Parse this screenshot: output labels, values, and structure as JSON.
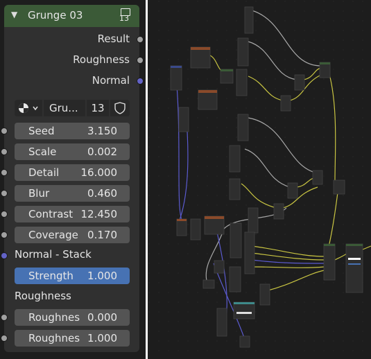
{
  "node": {
    "title": "Grunge 03",
    "user_count": "13",
    "outputs": [
      "Result",
      "Roughness",
      "Normal"
    ],
    "datablock": {
      "name": "Gru...",
      "users": "13"
    },
    "inputs": [
      {
        "label": "Seed",
        "value": "3.150"
      },
      {
        "label": "Scale",
        "value": "0.002"
      },
      {
        "label": "Detail",
        "value": "16.000"
      },
      {
        "label": "Blur",
        "value": "0.460"
      },
      {
        "label": "Contrast",
        "value": "12.450"
      },
      {
        "label": "Coverage",
        "value": "0.170"
      }
    ],
    "normal_stack_label": "Normal - Stack",
    "strength": {
      "label": "Strength",
      "value": "1.000"
    },
    "roughness_label": "Roughness",
    "roughness_inputs": [
      {
        "label": "Roughnes",
        "value": "0.000"
      },
      {
        "label": "Roughnes",
        "value": "1.000"
      }
    ]
  },
  "colors": {
    "header_green": "#3b5a37",
    "socket_grey": "#a1a1a1",
    "socket_blue": "#6363c7",
    "selected_blue": "#4772b3",
    "wire_yellow": "#c9c542",
    "wire_grey": "#a8a8a8",
    "wire_blue": "#5b5bd0"
  },
  "icons": [
    "chevron-down-icon",
    "node-group-icon",
    "sphere-icon",
    "fake-user-shield-icon"
  ]
}
